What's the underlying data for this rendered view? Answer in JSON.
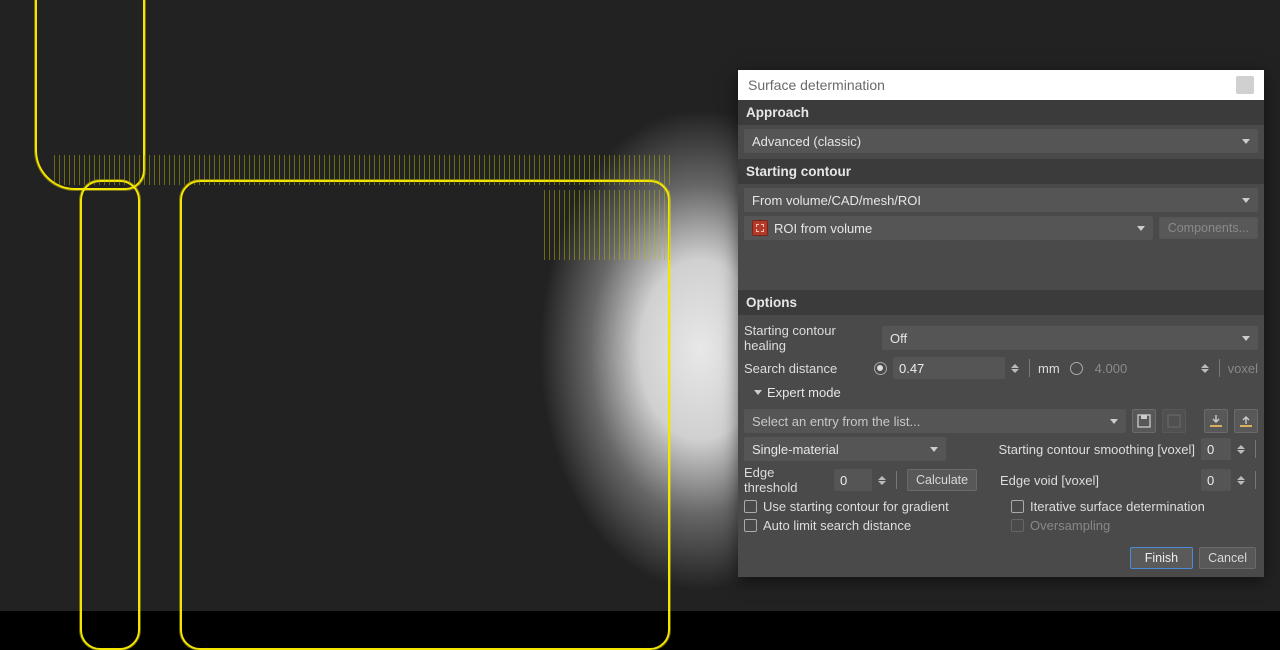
{
  "dialog": {
    "title": "Surface determination",
    "approach": {
      "header": "Approach",
      "value": "Advanced (classic)"
    },
    "starting_contour": {
      "header": "Starting contour",
      "source": "From volume/CAD/mesh/ROI",
      "roi": "ROI from volume",
      "components_btn": "Components..."
    },
    "options": {
      "header": "Options",
      "healing_label": "Starting contour healing",
      "healing_value": "Off",
      "search_distance_label": "Search distance",
      "search_distance_mm": "0.47",
      "mm_unit": "mm",
      "search_distance_voxel": "4.000",
      "voxel_unit": "voxel",
      "expert_mode_label": "Expert mode",
      "entry_placeholder": "Select an entry from the list...",
      "material_mode": "Single-material",
      "smoothing_label": "Starting contour smoothing [voxel]",
      "smoothing_value": "0",
      "edge_threshold_label": "Edge threshold",
      "edge_threshold_value": "0",
      "calculate_btn": "Calculate",
      "edge_void_label": "Edge void [voxel]",
      "edge_void_value": "0",
      "use_gradient_label": "Use starting contour for gradient",
      "iterative_label": "Iterative surface determination",
      "auto_limit_label": "Auto limit search distance",
      "oversampling_label": "Oversampling"
    },
    "footer": {
      "finish": "Finish",
      "cancel": "Cancel"
    }
  }
}
